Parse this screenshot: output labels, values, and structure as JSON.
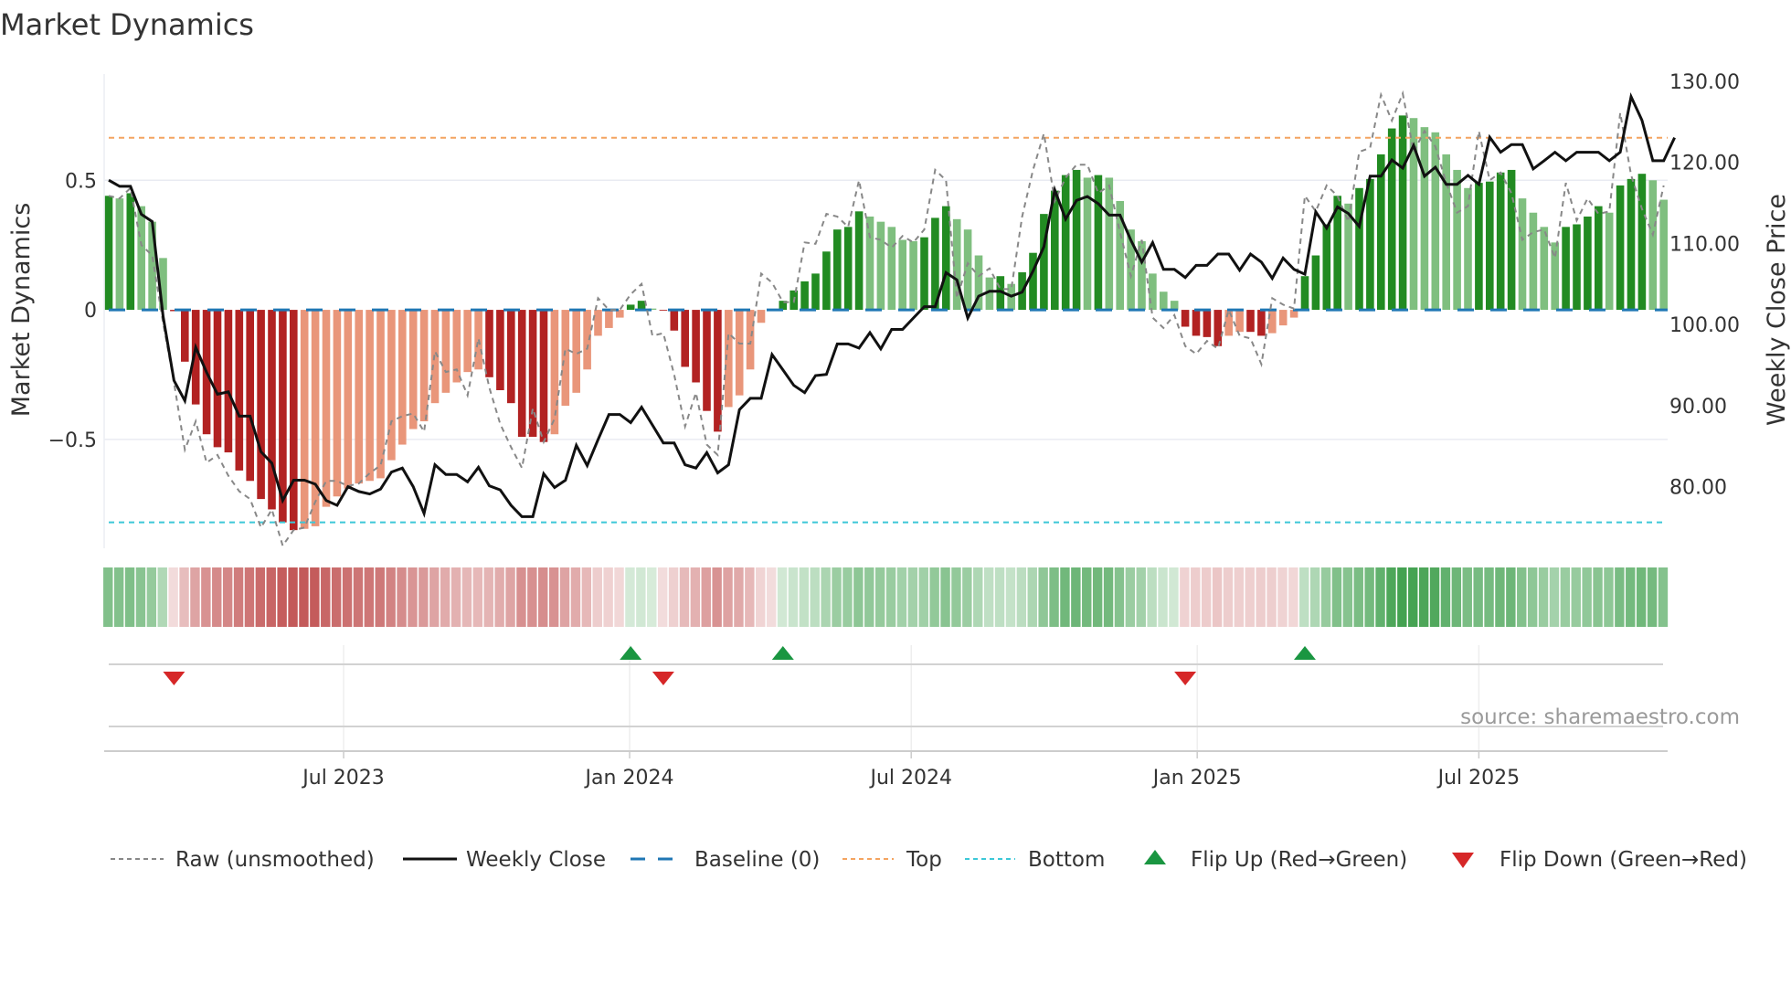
{
  "title": "Market Dynamics",
  "source": "source: sharemaestro.com",
  "colors": {
    "green_strong": "#228b22",
    "green_weak": "#7fbf7f",
    "red_strong": "#b22222",
    "red_weak": "#e9967a",
    "raw": "#888888",
    "close": "#111111",
    "baseline": "#1f77b4",
    "top": "#f4a460",
    "bottom": "#3cc8d8",
    "flip_up": "#1a9641",
    "flip_down": "#d62728"
  },
  "chart_data": {
    "type": "bar+line",
    "title": "Market Dynamics",
    "ylabel": "Market Dynamics",
    "y2label": "Weekly Close Price",
    "ylim": [
      -0.92,
      0.91
    ],
    "y2lim": [
      72.4,
      130.9
    ],
    "yticks": [
      {
        "v": 0.5,
        "label": "0.5"
      },
      {
        "v": 0,
        "label": "0"
      },
      {
        "v": -0.5,
        "label": "−0.5"
      }
    ],
    "y2ticks": [
      {
        "v": 130,
        "label": "130.00"
      },
      {
        "v": 120,
        "label": "120.00"
      },
      {
        "v": 110,
        "label": "110.00"
      },
      {
        "v": 100,
        "label": "100.00"
      },
      {
        "v": 90,
        "label": "90.00"
      },
      {
        "v": 80,
        "label": "80.00"
      }
    ],
    "xticks": [
      {
        "week": 21.6,
        "label": "Jul 2023"
      },
      {
        "week": 47.9,
        "label": "Jan 2024"
      },
      {
        "week": 73.8,
        "label": "Jul 2024"
      },
      {
        "week": 100.1,
        "label": "Jan 2025"
      },
      {
        "week": 126.0,
        "label": "Jul 2025"
      }
    ],
    "top_level": 0.664,
    "bottom_level": -0.82,
    "baseline": 0,
    "momentum": [
      0.44,
      0.43,
      0.45,
      0.4,
      0.34,
      0.2,
      -0.005,
      -0.2,
      -0.365,
      -0.48,
      -0.53,
      -0.55,
      -0.62,
      -0.66,
      -0.73,
      -0.77,
      -0.82,
      -0.85,
      -0.845,
      -0.835,
      -0.76,
      -0.72,
      -0.69,
      -0.67,
      -0.66,
      -0.65,
      -0.58,
      -0.52,
      -0.46,
      -0.43,
      -0.36,
      -0.32,
      -0.28,
      -0.24,
      -0.23,
      -0.26,
      -0.31,
      -0.36,
      -0.49,
      -0.49,
      -0.51,
      -0.48,
      -0.37,
      -0.32,
      -0.23,
      -0.1,
      -0.07,
      -0.03,
      0.02,
      0.035,
      0.005,
      -0.003,
      -0.08,
      -0.22,
      -0.28,
      -0.39,
      -0.47,
      -0.375,
      -0.33,
      -0.23,
      -0.05,
      -0.002,
      0.035,
      0.075,
      0.11,
      0.14,
      0.225,
      0.31,
      0.32,
      0.38,
      0.36,
      0.34,
      0.32,
      0.27,
      0.265,
      0.28,
      0.355,
      0.4,
      0.35,
      0.31,
      0.21,
      0.125,
      0.13,
      0.1,
      0.145,
      0.22,
      0.37,
      0.46,
      0.52,
      0.54,
      0.51,
      0.52,
      0.51,
      0.42,
      0.31,
      0.265,
      0.14,
      0.07,
      0.035,
      -0.065,
      -0.1,
      -0.105,
      -0.14,
      -0.1,
      -0.085,
      -0.085,
      -0.1,
      -0.09,
      -0.06,
      -0.03,
      0.13,
      0.21,
      0.33,
      0.44,
      0.41,
      0.47,
      0.505,
      0.6,
      0.7,
      0.75,
      0.74,
      0.705,
      0.685,
      0.6,
      0.54,
      0.47,
      0.49,
      0.495,
      0.53,
      0.54,
      0.43,
      0.375,
      0.32,
      0.26,
      0.32,
      0.33,
      0.36,
      0.4,
      0.375,
      0.48,
      0.505,
      0.525,
      0.5,
      0.425
    ],
    "raw": [
      0.44,
      0.43,
      0.47,
      0.25,
      0.21,
      -0.05,
      -0.28,
      -0.54,
      -0.43,
      -0.59,
      -0.56,
      -0.64,
      -0.7,
      -0.73,
      -0.84,
      -0.77,
      -0.91,
      -0.85,
      -0.84,
      -0.74,
      -0.66,
      -0.66,
      -0.68,
      -0.67,
      -0.63,
      -0.6,
      -0.43,
      -0.41,
      -0.4,
      -0.47,
      -0.16,
      -0.24,
      -0.23,
      -0.33,
      -0.11,
      -0.3,
      -0.44,
      -0.53,
      -0.61,
      -0.38,
      -0.51,
      -0.42,
      -0.15,
      -0.17,
      -0.15,
      0.045,
      0,
      0,
      0.06,
      0.1,
      -0.1,
      -0.09,
      -0.25,
      -0.45,
      -0.32,
      -0.52,
      -0.56,
      -0.09,
      -0.13,
      -0.13,
      0.14,
      0.105,
      0.03,
      0.03,
      0.26,
      0.255,
      0.37,
      0.36,
      0.32,
      0.5,
      0.28,
      0.27,
      0.24,
      0.285,
      0.26,
      0.31,
      0.54,
      0.5,
      0.045,
      0.18,
      0.13,
      0.16,
      0.08,
      0.08,
      0.36,
      0.54,
      0.68,
      0.42,
      0.51,
      0.56,
      0.56,
      0.45,
      0.48,
      0.3,
      0.13,
      0.27,
      -0.03,
      -0.07,
      -0.02,
      -0.14,
      -0.17,
      -0.12,
      -0.15,
      0,
      -0.1,
      -0.11,
      -0.21,
      0.045,
      0.02,
      0.005,
      0.44,
      0.38,
      0.48,
      0.44,
      0.34,
      0.61,
      0.625,
      0.83,
      0.73,
      0.835,
      0.61,
      0.69,
      0.63,
      0.49,
      0.375,
      0.4,
      0.69,
      0.5,
      0.53,
      0.45,
      0.27,
      0.3,
      0.31,
      0.2,
      0.49,
      0.345,
      0.43,
      0.37,
      0.38,
      0.76,
      0.52,
      0.39,
      0.29,
      0.48
    ],
    "weekly_close": [
      117.8,
      117.05,
      117.05,
      113.6,
      112.7,
      101.0,
      93.1,
      90.6,
      97.2,
      94.1,
      91.4,
      91.7,
      88.7,
      88.7,
      84.3,
      82.9,
      78.3,
      80.8,
      80.8,
      80.3,
      78.3,
      77.7,
      80.0,
      79.4,
      79.1,
      79.7,
      81.8,
      82.3,
      80.0,
      76.7,
      82.7,
      81.5,
      81.5,
      80.6,
      82.4,
      80.1,
      79.6,
      77.7,
      76.3,
      76.3,
      81.6,
      79.9,
      80.8,
      85.1,
      82.6,
      85.8,
      88.9,
      88.9,
      87.9,
      89.8,
      87.6,
      85.4,
      85.4,
      82.7,
      82.3,
      84.2,
      81.7,
      82.7,
      89.5,
      90.9,
      90.9,
      96.3,
      94.4,
      92.5,
      91.6,
      93.7,
      93.85,
      97.6,
      97.6,
      97.1,
      99.0,
      97.0,
      99.4,
      99.4,
      100.8,
      102.2,
      102.2,
      106.4,
      105.5,
      100.8,
      103.5,
      104.1,
      104.1,
      103.5,
      104.0,
      106.6,
      109.6,
      116.6,
      113.0,
      115.3,
      115.8,
      114.9,
      113.5,
      113.5,
      110.4,
      107.7,
      110.1,
      106.8,
      106.8,
      105.8,
      107.3,
      107.3,
      108.7,
      108.7,
      106.7,
      108.7,
      107.7,
      105.7,
      108.2,
      106.8,
      106.2,
      113.9,
      111.9,
      114.5,
      113.7,
      112.1,
      118.3,
      118.3,
      120.3,
      119.3,
      122.1,
      118.3,
      119.4,
      117.3,
      117.3,
      118.4,
      117.3,
      123.1,
      121.25,
      122.2,
      122.2,
      119.2,
      120.2,
      121.25,
      120.2,
      121.25,
      121.25,
      121.25,
      120.2,
      121.25,
      128.1,
      125.2,
      120.2,
      120.2,
      123.05
    ],
    "flips": [
      {
        "week": 6,
        "dir": "down"
      },
      {
        "week": 48,
        "dir": "up"
      },
      {
        "week": 51,
        "dir": "down"
      },
      {
        "week": 62,
        "dir": "up"
      },
      {
        "week": 99,
        "dir": "down"
      },
      {
        "week": 110,
        "dir": "up"
      }
    ],
    "legend": {
      "placement": "bottom",
      "items": [
        {
          "key": "raw",
          "label": "Raw (unsmoothed)"
        },
        {
          "key": "close",
          "label": "Weekly Close"
        },
        {
          "key": "baseline",
          "label": "Baseline (0)"
        },
        {
          "key": "top",
          "label": "Top"
        },
        {
          "key": "bottom",
          "label": "Bottom"
        },
        {
          "key": "flip_up",
          "label": "Flip Up (Red→Green)"
        },
        {
          "key": "flip_down",
          "label": "Flip Down (Green→Red)"
        }
      ]
    }
  }
}
